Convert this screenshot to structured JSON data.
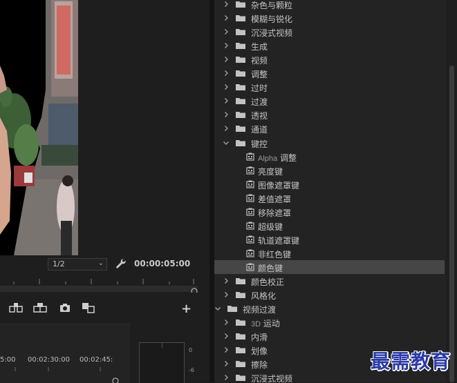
{
  "monitor": {
    "zoom_value": "1/2",
    "timecode": "00:00:05:00",
    "settings_icon": "wrench-icon",
    "buttons": [
      "insert-icon",
      "overwrite-icon",
      "camera-icon",
      "compare-icon"
    ],
    "add_label": "+"
  },
  "timeline": {
    "labels": [
      "5:00",
      "00:02:30:00",
      "00:02:45:"
    ]
  },
  "audio_meter": {
    "scale": [
      "0",
      "-6"
    ]
  },
  "effects": {
    "items": [
      {
        "label": "杂色与颗粒",
        "level": 1,
        "kind": "folder",
        "expanded": false
      },
      {
        "label": "模糊与锐化",
        "level": 1,
        "kind": "folder",
        "expanded": false
      },
      {
        "label": "沉浸式视频",
        "level": 1,
        "kind": "folder",
        "expanded": false
      },
      {
        "label": "生成",
        "level": 1,
        "kind": "folder",
        "expanded": false
      },
      {
        "label": "视频",
        "level": 1,
        "kind": "folder",
        "expanded": false
      },
      {
        "label": "调整",
        "level": 1,
        "kind": "folder",
        "expanded": false
      },
      {
        "label": "过时",
        "level": 1,
        "kind": "folder",
        "expanded": false
      },
      {
        "label": "过渡",
        "level": 1,
        "kind": "folder",
        "expanded": false
      },
      {
        "label": "透视",
        "level": 1,
        "kind": "folder",
        "expanded": false
      },
      {
        "label": "通道",
        "level": 1,
        "kind": "folder",
        "expanded": false
      },
      {
        "label": "键控",
        "level": 1,
        "kind": "folder",
        "expanded": true
      },
      {
        "label_latin": "Alpha",
        "label": " 调整",
        "level": 2,
        "kind": "preset"
      },
      {
        "label": "亮度键",
        "level": 2,
        "kind": "preset"
      },
      {
        "label": "图像遮罩键",
        "level": 2,
        "kind": "preset"
      },
      {
        "label": "差值遮罩",
        "level": 2,
        "kind": "preset"
      },
      {
        "label": "移除遮罩",
        "level": 2,
        "kind": "preset"
      },
      {
        "label": "超级键",
        "level": 2,
        "kind": "preset"
      },
      {
        "label": "轨道遮罩键",
        "level": 2,
        "kind": "preset"
      },
      {
        "label": "非红色键",
        "level": 2,
        "kind": "preset"
      },
      {
        "label": "颜色键",
        "level": 2,
        "kind": "preset",
        "selected": true
      },
      {
        "label": "颜色校正",
        "level": 1,
        "kind": "folder",
        "expanded": false
      },
      {
        "label": "风格化",
        "level": 1,
        "kind": "folder",
        "expanded": false
      },
      {
        "label": "视频过渡",
        "level": 0,
        "kind": "folder",
        "expanded": true
      },
      {
        "label_latin": "3D",
        "label": " 运动",
        "level": 1,
        "kind": "folder",
        "expanded": false
      },
      {
        "label": "内滑",
        "level": 1,
        "kind": "folder",
        "expanded": false
      },
      {
        "label": "划像",
        "level": 1,
        "kind": "folder",
        "expanded": false
      },
      {
        "label": "擦除",
        "level": 1,
        "kind": "folder",
        "expanded": false
      },
      {
        "label": "沉浸式视频",
        "level": 1,
        "kind": "folder",
        "expanded": false
      }
    ]
  },
  "watermark": "最需教育",
  "colors": {
    "panel_bg": "#232323",
    "selected_row": "#464646",
    "watermark_blue": "#2a3aa6"
  }
}
